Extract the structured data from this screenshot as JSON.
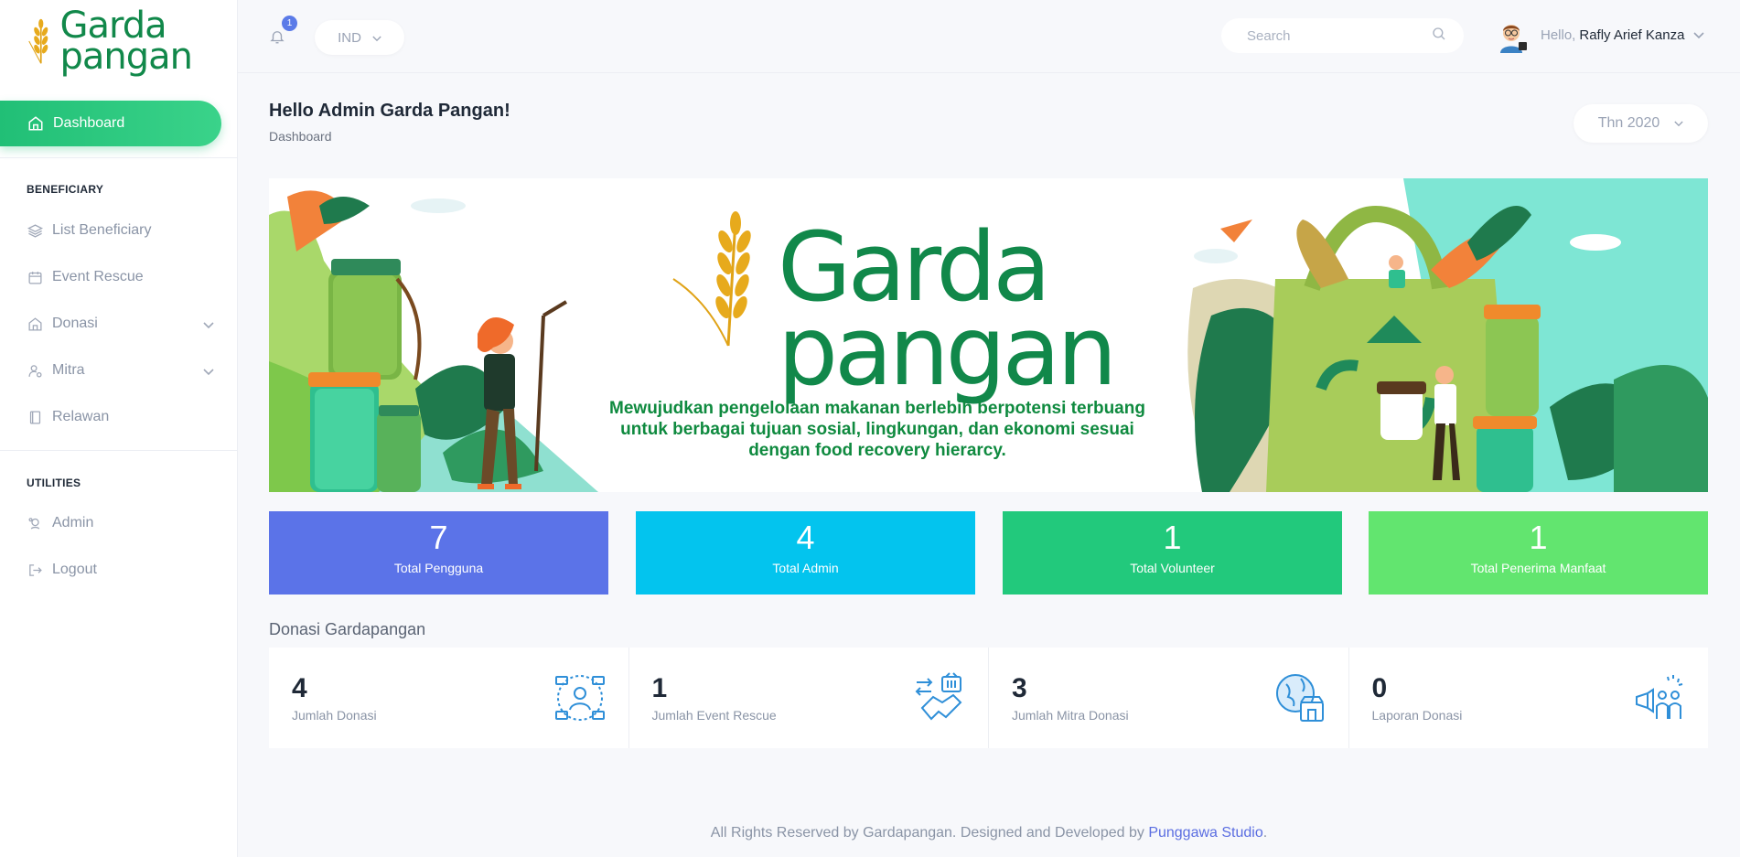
{
  "brand": {
    "logo_line1": "Garda",
    "logo_line2": "pangan"
  },
  "sidebar": {
    "active": {
      "label": "Dashboard"
    },
    "sections": [
      {
        "title": "BENEFICIARY",
        "items": [
          {
            "label": "List Beneficiary"
          },
          {
            "label": "Event Rescue"
          },
          {
            "label": "Donasi"
          },
          {
            "label": "Mitra"
          },
          {
            "label": "Relawan"
          }
        ]
      },
      {
        "title": "UTILITIES",
        "items": [
          {
            "label": "Admin"
          },
          {
            "label": "Logout"
          }
        ]
      }
    ]
  },
  "topbar": {
    "notification_count": "1",
    "language": "IND",
    "search_placeholder": "Search",
    "greeting": "Hello,",
    "user_name": "Rafly Arief Kanza"
  },
  "header": {
    "title": "Hello Admin Garda Pangan!",
    "breadcrumb": "Dashboard",
    "year_filter": "Thn 2020"
  },
  "banner": {
    "logo_line1": "Garda",
    "logo_line2": "pangan",
    "tagline_line1": "Mewujudkan pengelolaan makanan berlebih berpotensi terbuang",
    "tagline_line2": "untuk berbagai tujuan sosial, lingkungan, dan ekonomi sesuai",
    "tagline_line3": "dengan food recovery hierarcy."
  },
  "stats": [
    {
      "value": "7",
      "label": "Total Pengguna",
      "color": "#5b73e8"
    },
    {
      "value": "4",
      "label": "Total Admin",
      "color": "#03c4ee"
    },
    {
      "value": "1",
      "label": "Total Volunteer",
      "color": "#22c97c"
    },
    {
      "value": "1",
      "label": "Total Penerima Manfaat",
      "color": "#62e56f"
    }
  ],
  "donasi": {
    "title": "Donasi Gardapangan",
    "cards": [
      {
        "value": "4",
        "label": "Jumlah Donasi",
        "icon": "donor-basket-icon"
      },
      {
        "value": "1",
        "label": "Jumlah Event Rescue",
        "icon": "handshake-basket-icon"
      },
      {
        "value": "3",
        "label": "Jumlah Mitra Donasi",
        "icon": "globe-store-icon"
      },
      {
        "value": "0",
        "label": "Laporan Donasi",
        "icon": "megaphone-people-icon"
      }
    ]
  },
  "footer": {
    "text": "All Rights Reserved by Gardapangan. Designed and Developed by",
    "link": "Punggawa Studio",
    "end": "."
  },
  "colors": {
    "brand_green": "#11884a",
    "accent_green": "#22c97c",
    "link_blue": "#5b6ee1"
  }
}
